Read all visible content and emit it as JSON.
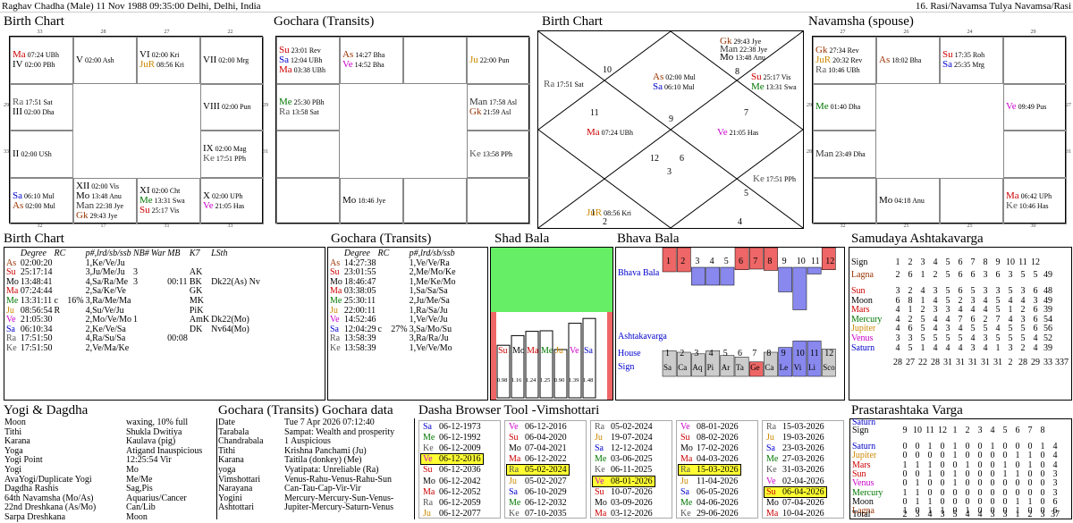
{
  "header": {
    "left": "Raghav Chadha (Male) 11 Nov 1988 09:35:00  Delhi, Delhi, India",
    "right": "16. Rasi/Navamsa Tulya Navamsa/Rasi"
  },
  "colors": {
    "Su": "#cc0000",
    "Mo": "#000000",
    "Ma": "#cc0000",
    "Me": "#007700",
    "Ju": "#cc8800",
    "Ve": "#cc00cc",
    "Sa": "#0000cc",
    "Ra": "#555555",
    "Ke": "#555555",
    "As": "#993300",
    "Gk": "#993300",
    "JuR": "#cc8800",
    "Man": "#333333",
    "Lagna": "#993300"
  },
  "titles": {
    "birth_chart": "Birth Chart",
    "gochara": "Gochara (Transits)",
    "birth_chart_n": "Birth Chart",
    "navamsha": "Navamsha  (spouse)",
    "birth_table": "Birth Chart",
    "gochara_table": "Gochara (Transits)",
    "shad_bala": "Shad Bala",
    "bhava_bala": "Bhava Bala",
    "samudaya": "Samudaya Ashtakavarga",
    "yogi": "Yogi & Dagdha",
    "gochara_data": "Gochara (Transits) Gochara data",
    "dasha": "Dasha Browser Tool -Vimshottari",
    "prastar": "Prastarashtaka Varga"
  },
  "sq_ticks": {
    "top": [
      "33",
      "28",
      "27",
      "22"
    ],
    "bottom": [
      "32",
      "17",
      "31",
      "33"
    ],
    "left": [
      "29",
      "33"
    ],
    "right": [
      "29",
      "31"
    ]
  },
  "nav_ticks": {
    "top": [
      "27",
      "26",
      "24",
      "29"
    ],
    "bottom": [
      "32",
      "25",
      "25",
      "30"
    ],
    "left": [
      "29",
      "28"
    ],
    "right": [
      "27",
      "31"
    ]
  },
  "birth_chart": {
    "c0": [
      [
        "Ma",
        "07:24 UBh"
      ],
      [
        "IV",
        "02:00 PBh"
      ]
    ],
    "c1": [
      [
        "V",
        "02:00 Ash"
      ]
    ],
    "c2": [
      [
        "VI",
        "02:00 Kri"
      ],
      [
        "JuR",
        "08:56 Kri"
      ]
    ],
    "c3": [
      [
        "VII",
        "02:00 Mrg"
      ]
    ],
    "c4": [
      [
        "Ra",
        "17:51 Sat"
      ],
      [
        "III",
        "02:00 Dha"
      ]
    ],
    "c5": [
      [
        "VIII",
        "02:00 Pun"
      ]
    ],
    "c6": [
      [
        "II",
        "02:00 USh"
      ]
    ],
    "c7": [
      [
        "IX",
        "02:00 Mag"
      ],
      [
        "Ke",
        "17:51 PPh"
      ]
    ],
    "c8": [
      [
        "Sa",
        "06:10 Mul"
      ],
      [
        "As",
        "02:00 Mul"
      ]
    ],
    "c9": [
      [
        "XII",
        "02:00 Vis"
      ],
      [
        "Mo",
        "13:48 Anu"
      ],
      [
        "Man",
        "22:38 Jye"
      ],
      [
        "Gk",
        "29:43 Jye"
      ]
    ],
    "c10": [
      [
        "XI",
        "02:00 Cht"
      ],
      [
        "Me",
        "13:31 Swa"
      ],
      [
        "Su",
        "25:17 Vis"
      ]
    ],
    "c11": [
      [
        "X",
        "02:00 UPh"
      ],
      [
        "Ve",
        "21:05 Has"
      ]
    ]
  },
  "gochara_chart": {
    "c0": [
      [
        "Su",
        "23:01 Rev"
      ],
      [
        "Sa",
        "12:04 UBh"
      ],
      [
        "Ma",
        "03:38 UBh"
      ]
    ],
    "c1": [
      [
        "As",
        "14:27 Bha"
      ],
      [
        "Ve",
        "14:52 Bha"
      ]
    ],
    "c2": [],
    "c3": [
      [
        "Ju",
        "22:00 Pun"
      ]
    ],
    "c4": [
      [
        "Me",
        "25:30 PBh"
      ],
      [
        "Ra",
        "13:58 Sat"
      ]
    ],
    "c5": [
      [
        "Man",
        "17:58 Asl"
      ],
      [
        "Gk",
        "21:59 Asl"
      ]
    ],
    "c6": [],
    "c7": [
      [
        "Ke",
        "13:58 PPh"
      ]
    ],
    "c8": [],
    "c9": [
      [
        "Mo",
        "18:46 Jye"
      ]
    ],
    "c10": [],
    "c11": []
  },
  "north_chart": {
    "houses": [
      "9",
      "10",
      "11",
      "12",
      "1",
      "2",
      "3",
      "4",
      "5",
      "6",
      "7",
      "8"
    ],
    "p_top": [
      [
        "Gk",
        "29:43 Jye"
      ],
      [
        "Man",
        "22:38 Jye"
      ],
      [
        "Mo",
        "13:48 Anu"
      ]
    ],
    "p_tl": [
      [
        "As",
        "02:00 Mul"
      ],
      [
        "Sa",
        "06:10 Mul"
      ]
    ],
    "p_tr": [
      [
        "Su",
        "25:17 Vis"
      ],
      [
        "Me",
        "13:31 Swa"
      ]
    ],
    "p_ra": [
      [
        "Ra",
        "17:51 Sat"
      ]
    ],
    "p_ma": [
      [
        "Ma",
        "07:24 UBh"
      ]
    ],
    "p_ve": [
      [
        "Ve",
        "21:05 Has"
      ]
    ],
    "p_ke": [
      [
        "Ke",
        "17:51 PPh"
      ]
    ],
    "p_ju": [
      [
        "JuR",
        "08:56 Kri"
      ]
    ]
  },
  "navamsha": {
    "c0": [
      [
        "Gk",
        "27:34 Rev"
      ],
      [
        "JuR",
        "20:32 Rev"
      ],
      [
        "Ra",
        "10:46 UBh"
      ]
    ],
    "c1": [
      [
        "As",
        "18:02 Bha"
      ]
    ],
    "c2": [
      [
        "Su",
        "17:35 Roh"
      ],
      [
        "Sa",
        "25:35 Mrg"
      ]
    ],
    "c3": [],
    "c4": [
      [
        "Me",
        "01:40 Dha"
      ]
    ],
    "c5": [
      [
        "Ve",
        "09:49 Pus"
      ]
    ],
    "c6": [
      [
        "Man",
        "23:49 Dha"
      ]
    ],
    "c7": [],
    "c8": [],
    "c9": [
      [
        "Mo",
        "04:18 Anu"
      ]
    ],
    "c10": [],
    "c11": [
      [
        "Ma",
        "06:42 UPh"
      ],
      [
        "Ke",
        "10:46 Has"
      ]
    ]
  },
  "birth_table": {
    "headers": [
      "Degree",
      "RC",
      "",
      "p#,lrd/sb/ssb",
      "NB#",
      "War",
      "MB",
      "K7",
      "LSth"
    ],
    "rows": [
      [
        "As",
        "02:00:20",
        "",
        "",
        "1,Ke/Ve/Ju",
        "",
        "",
        "",
        "",
        ""
      ],
      [
        "Su",
        "25:17:14",
        "",
        "",
        "3,Ju/Me/Ju",
        "3",
        "",
        "",
        "AK",
        ""
      ],
      [
        "Mo",
        "13:48:41",
        "",
        "",
        "4,Sa/Ra/Me",
        "3",
        "",
        "00:11",
        "BK",
        "Dk22(As) Nv"
      ],
      [
        "Ma",
        "07:24:44",
        "",
        "",
        "2,Sa/Ke/Ve",
        "",
        "",
        "",
        "GK",
        ""
      ],
      [
        "Me",
        "13:31:11",
        "c",
        "16%",
        "3,Ra/Me/Ma",
        "",
        "",
        "",
        "MK",
        ""
      ],
      [
        "Ju",
        "08:56:54",
        "R",
        "",
        "4,Su/Ve/Ju",
        "",
        "",
        "",
        "PiK",
        ""
      ],
      [
        "Ve",
        "21:05:30",
        "",
        "",
        "2,Mo/Ve/Mo",
        "1",
        "",
        "",
        "AmK",
        "Dk22(Mo)"
      ],
      [
        "Sa",
        "06:10:34",
        "",
        "",
        "2,Ke/Ve/Sa",
        "",
        "",
        "",
        "DK",
        "Nv64(Mo)"
      ],
      [
        "Ra",
        "17:51:50",
        "",
        "",
        "4,Ra/Su/Sa",
        "",
        "",
        "00:08",
        "",
        ""
      ],
      [
        "Ke",
        "17:51:50",
        "",
        "",
        "2,Ve/Ma/Ke",
        "",
        "",
        "",
        "",
        ""
      ]
    ]
  },
  "gochara_table": {
    "headers": [
      "Degree",
      "RC",
      "",
      "p#,lrd/sb/ssb"
    ],
    "rows": [
      [
        "As",
        "14:27:38",
        "",
        "",
        "1,Ve/Ve/Ra"
      ],
      [
        "Su",
        "23:01:55",
        "",
        "",
        "2,Me/Mo/Ke"
      ],
      [
        "Mo",
        "18:46:47",
        "",
        "",
        "1,Me/Ke/Mo"
      ],
      [
        "Ma",
        "03:38:05",
        "",
        "",
        "1,Sa/Sa/Sa"
      ],
      [
        "Me",
        "25:30:11",
        "",
        "",
        "2,Ju/Me/Sa"
      ],
      [
        "Ju",
        "22:00:11",
        "",
        "",
        "1,Ra/Sa/Ju"
      ],
      [
        "Ve",
        "14:52:46",
        "",
        "",
        "1,Ve/Ve/Ju"
      ],
      [
        "Sa",
        "12:04:29",
        "c",
        "27%",
        "3,Sa/Mo/Su"
      ],
      [
        "Ra",
        "13:58:39",
        "",
        "",
        "3,Ra/Ra/Ju"
      ],
      [
        "Ke",
        "13:58:39",
        "",
        "",
        "1,Ve/Ve/Mo"
      ]
    ]
  },
  "shad_bala": {
    "planets": [
      "Su",
      "Mo",
      "Ma",
      "Me",
      "Ju",
      "Ve",
      "Sa"
    ],
    "values": [
      0.98,
      1.16,
      1.24,
      1.25,
      0.9,
      1.39,
      1.48
    ],
    "labels": [
      "0.98",
      "1.16",
      "1.24",
      "1.25",
      "0.90",
      "1.39",
      "1.48"
    ]
  },
  "bhava_bala": {
    "label_top": "Bhava Bala",
    "label_bottom": "Ashtakavarga",
    "label_house": "House",
    "label_sign": "Sign",
    "houses": [
      "1",
      "2",
      "3",
      "4",
      "5",
      "6",
      "7",
      "8",
      "9",
      "10",
      "11",
      "12"
    ],
    "signs": [
      "Sa",
      "Ca",
      "Aq",
      "Pi",
      "Ar",
      "Ta",
      "Ge",
      "Ca",
      "Le",
      "Vi",
      "Li",
      "Sco"
    ],
    "top_vals": [
      -2,
      -2,
      0.8,
      0.8,
      0.8,
      -1.1,
      -0.8,
      -1.4,
      1.1,
      1.9,
      0.3,
      -1.1
    ],
    "bot_vals": [
      1.6,
      1.5,
      1.4,
      1.6,
      1.3,
      1.2,
      0.9,
      1.5,
      1.8,
      2.2,
      2.2,
      1.7
    ]
  },
  "samudaya": {
    "header": [
      "Sign",
      "1",
      "2",
      "3",
      "4",
      "5",
      "6",
      "7",
      "8",
      "9",
      "10",
      "11",
      "12",
      ""
    ],
    "lagna": [
      "Lagna",
      "2",
      "6",
      "1",
      "2",
      "5",
      "6",
      "6",
      "3",
      "6",
      "3",
      "5",
      "5",
      "49"
    ],
    "rows": [
      [
        "Sun",
        "3",
        "2",
        "4",
        "3",
        "5",
        "6",
        "5",
        "3",
        "3",
        "5",
        "3",
        "6",
        "48"
      ],
      [
        "Moon",
        "6",
        "8",
        "1",
        "4",
        "5",
        "2",
        "3",
        "4",
        "5",
        "4",
        "4",
        "3",
        "49"
      ],
      [
        "Mars",
        "4",
        "1",
        "2",
        "3",
        "3",
        "4",
        "4",
        "4",
        "5",
        "1",
        "2",
        "6",
        "39"
      ],
      [
        "Mercury",
        "4",
        "2",
        "5",
        "4",
        "4",
        "7",
        "6",
        "2",
        "7",
        "4",
        "3",
        "6",
        "54"
      ],
      [
        "Jupiter",
        "4",
        "6",
        "5",
        "4",
        "3",
        "4",
        "5",
        "5",
        "4",
        "5",
        "5",
        "6",
        "56"
      ],
      [
        "Venus",
        "3",
        "3",
        "5",
        "5",
        "5",
        "5",
        "4",
        "3",
        "5",
        "5",
        "5",
        "4",
        "52"
      ],
      [
        "Saturn",
        "4",
        "5",
        "1",
        "4",
        "4",
        "4",
        "3",
        "4",
        "1",
        "3",
        "2",
        "4",
        "39"
      ]
    ],
    "totals": [
      "",
      "28",
      "27",
      "22",
      "28",
      "31",
      "31",
      "31",
      "31",
      "31",
      "2",
      "28",
      "29",
      "33",
      "337"
    ]
  },
  "yogi": [
    [
      "Moon",
      "waxing, 10% full"
    ],
    [
      "Tithi",
      "Shukla Dwitiya"
    ],
    [
      "Karana",
      "Kaulava (pig)"
    ],
    [
      "Yoga",
      "Atigand Inauspicious"
    ],
    [
      "Yogi Point",
      "12:25:54 Vir"
    ],
    [
      "Yogi",
      "Mo"
    ],
    [
      "AvaYogi/Duplicate Yogi",
      "Me/Me"
    ],
    [
      "Dagdha Rashis",
      "Sag,Pis"
    ],
    [
      "64th Navamsha (Mo/As)",
      "Aquarius/Cancer"
    ],
    [
      "22nd Dreshkana (As/Mo)",
      "Can/Lib"
    ],
    [
      "Sarpa Dreshkana",
      "Moon"
    ]
  ],
  "gochara_data": [
    [
      "Date",
      "Tue 7 Apr 2026  07:12:40"
    ],
    [
      "Tarabala",
      "Sampat: Wealth and prosperity"
    ],
    [
      "Chandrabala",
      "1 Auspicious"
    ],
    [
      "Tithi",
      "Krishna Panchami (Ju)"
    ],
    [
      "Karana",
      "Taitila (donkey) (Me)"
    ],
    [
      "yoga",
      "Vyatipata: Unreliable (Ra)"
    ],
    [
      "Vimshottari",
      "Venus-Rahu-Venus-Rahu-Sun"
    ],
    [
      "Narayana",
      "Can-Tau-Cap-Vir-Vir"
    ],
    [
      "Yogini",
      "Mercury-Mercury-Sun-Venus-"
    ],
    [
      "Ashtottari",
      "Jupiter-Mercury-Saturn-Venus"
    ]
  ],
  "dasha": [
    [
      [
        "Sa",
        "06-12-1973",
        ""
      ],
      [
        "Me",
        "06-12-1992",
        ""
      ],
      [
        "Ke",
        "06-12-2009",
        ""
      ],
      [
        "Ve",
        "06-12-2016",
        "hl"
      ],
      [
        "Su",
        "06-12-2036",
        ""
      ],
      [
        "Mo",
        "06-12-2042",
        ""
      ],
      [
        "Ma",
        "06-12-2052",
        ""
      ],
      [
        "Ra",
        "06-12-2059",
        ""
      ],
      [
        "Ju",
        "06-12-2077",
        ""
      ]
    ],
    [
      [
        "Ve",
        "06-12-2016",
        ""
      ],
      [
        "Su",
        "06-04-2020",
        ""
      ],
      [
        "Mo",
        "07-04-2021",
        ""
      ],
      [
        "Ma",
        "06-12-2022",
        ""
      ],
      [
        "Ra",
        "05-02-2024",
        "hl"
      ],
      [
        "Ju",
        "05-02-2027",
        ""
      ],
      [
        "Sa",
        "06-10-2029",
        ""
      ],
      [
        "Me",
        "06-12-2032",
        ""
      ],
      [
        "Ke",
        "07-10-2035",
        ""
      ]
    ],
    [
      [
        "Ra",
        "05-02-2024",
        ""
      ],
      [
        "Ju",
        "19-07-2024",
        ""
      ],
      [
        "Sa",
        "12-12-2024",
        ""
      ],
      [
        "Me",
        "03-06-2025",
        ""
      ],
      [
        "Ke",
        "06-11-2025",
        ""
      ],
      [
        "Ve",
        "08-01-2026",
        "hl"
      ],
      [
        "Su",
        "10-07-2026",
        ""
      ],
      [
        "Mo",
        "03-09-2026",
        ""
      ],
      [
        "Ma",
        "03-12-2026",
        ""
      ]
    ],
    [
      [
        "Ve",
        "08-01-2026",
        ""
      ],
      [
        "Su",
        "08-02-2026",
        ""
      ],
      [
        "Mo",
        "17-02-2026",
        ""
      ],
      [
        "Ma",
        "04-03-2026",
        ""
      ],
      [
        "Ra",
        "15-03-2026",
        "hl"
      ],
      [
        "Ju",
        "11-04-2026",
        ""
      ],
      [
        "Sa",
        "06-05-2026",
        ""
      ],
      [
        "Me",
        "04-06-2026",
        ""
      ],
      [
        "Ke",
        "29-06-2026",
        ""
      ]
    ],
    [
      [
        "Ra",
        "15-03-2026",
        ""
      ],
      [
        "Ju",
        "19-03-2026",
        ""
      ],
      [
        "Sa",
        "23-03-2026",
        ""
      ],
      [
        "Me",
        "27-03-2026",
        ""
      ],
      [
        "Ke",
        "31-03-2026",
        ""
      ],
      [
        "Ve",
        "02-04-2026",
        ""
      ],
      [
        "Su",
        "06-04-2026",
        "hl"
      ],
      [
        "Mo",
        "07-04-2026",
        ""
      ],
      [
        "Ma",
        "10-04-2026",
        ""
      ]
    ]
  ],
  "prastar": {
    "saturn_label": "Saturn",
    "sign_label": "Sign",
    "signs": [
      "9",
      "10",
      "11",
      "12",
      "1",
      "2",
      "3",
      "4",
      "5",
      "6",
      "7",
      "8"
    ],
    "rows": [
      [
        "Saturn",
        "0",
        "0",
        "1",
        "0",
        "1",
        "0",
        "0",
        "1",
        "0",
        "0",
        "0",
        "1",
        "4"
      ],
      [
        "Jupiter",
        "0",
        "0",
        "0",
        "0",
        "1",
        "0",
        "0",
        "0",
        "0",
        "1",
        "1",
        "0",
        "4"
      ],
      [
        "Mars",
        "1",
        "1",
        "1",
        "0",
        "0",
        "1",
        "0",
        "0",
        "1",
        "0",
        "1",
        "0",
        "4"
      ],
      [
        "Sun",
        "0",
        "0",
        "1",
        "0",
        "1",
        "0",
        "0",
        "0",
        "1",
        "1",
        "0",
        "0",
        "3"
      ],
      [
        "Venus",
        "0",
        "1",
        "0",
        "0",
        "1",
        "0",
        "0",
        "0",
        "0",
        "0",
        "0",
        "0",
        "3"
      ],
      [
        "Mercury",
        "1",
        "1",
        "0",
        "0",
        "0",
        "0",
        "0",
        "0",
        "0",
        "0",
        "0",
        "0",
        "3"
      ],
      [
        "Moon",
        "0",
        "1",
        "1",
        "0",
        "0",
        "0",
        "0",
        "0",
        "0",
        "1",
        "1",
        "0",
        "6"
      ],
      [
        "Lagna",
        "1",
        "0",
        "1",
        "1",
        "0",
        "1",
        "0",
        "0",
        "0",
        "1",
        "0",
        "0",
        "6"
      ]
    ],
    "total_label": "Total",
    "totals": [
      "2",
      "3",
      "4",
      "3",
      "5",
      "4",
      "4",
      "3",
      "3",
      "1",
      "2",
      "3",
      "37"
    ]
  }
}
